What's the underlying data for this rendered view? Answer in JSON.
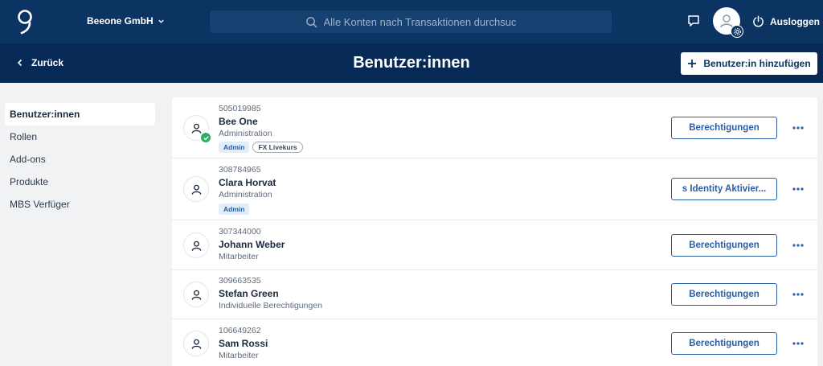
{
  "header": {
    "company": "Beeone GmbH",
    "search_placeholder": "Alle Konten nach Transaktionen durchsuchen",
    "logout_label": "Ausloggen"
  },
  "subheader": {
    "back_label": "Zurück",
    "title": "Benutzer:innen",
    "add_label": "Benutzer:in hinzufügen"
  },
  "sidebar": {
    "items": [
      {
        "label": "Benutzer:innen",
        "active": true
      },
      {
        "label": "Rollen"
      },
      {
        "label": "Add-ons"
      },
      {
        "label": "Produkte"
      },
      {
        "label": "MBS Verfüger"
      }
    ]
  },
  "users": [
    {
      "id": "505019985",
      "name": "Bee One",
      "role": "Administration",
      "badges": [
        "Admin",
        "FX Livekurs"
      ],
      "button": "Berechtigungen",
      "verified": true
    },
    {
      "id": "308784965",
      "name": "Clara Horvat",
      "role": "Administration",
      "badges": [
        "Admin"
      ],
      "button": "s Identity Aktivier..."
    },
    {
      "id": "307344000",
      "name": "Johann Weber",
      "role": "Mitarbeiter",
      "button": "Berechtigungen"
    },
    {
      "id": "309663535",
      "name": "Stefan Green",
      "role": "Individuelle Berechtigungen",
      "button": "Berechtigungen"
    },
    {
      "id": "106649262",
      "name": "Sam Rossi",
      "role": "Mitarbeiter",
      "button": "Berechtigungen"
    }
  ],
  "colors": {
    "topbar": "#0c3463",
    "subheader": "#062a55",
    "accent": "#2a5ea5",
    "success": "#27ae60"
  }
}
